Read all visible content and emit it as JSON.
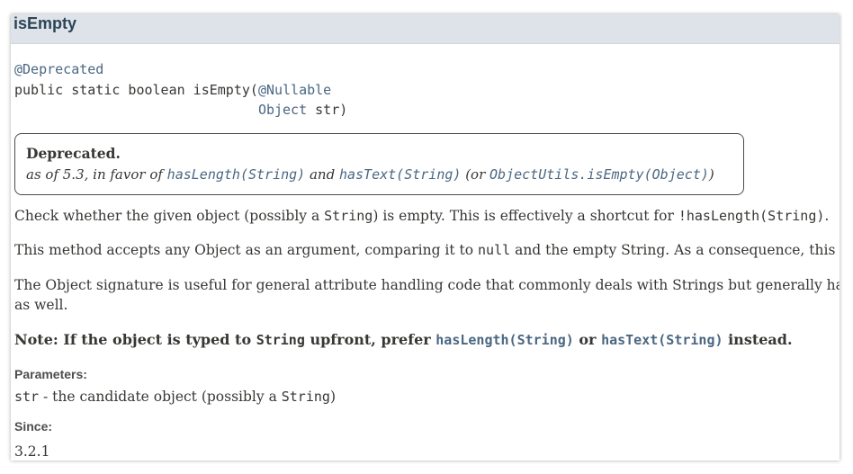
{
  "header": {
    "title": "isEmpty"
  },
  "signature": {
    "annotation": "@Deprecated",
    "declaration": "public static boolean isEmpty(",
    "param_annotation": "@Nullable",
    "param_type": "Object",
    "param_name": " str)"
  },
  "deprecation": {
    "title": "Deprecated.",
    "prefix": "as of 5.3, in favor of ",
    "link1": "hasLength(String)",
    "and": " and ",
    "link2": "hasText(String)",
    "or": " (or ",
    "link3": "ObjectUtils.isEmpty(Object)",
    "suffix": ")"
  },
  "description": {
    "p1_a": "Check whether the given object (possibly a ",
    "p1_code1": "String",
    "p1_b": ") is empty. This is effectively a shortcut for ",
    "p1_code2": "!hasLength(String)",
    "p1_c": ".",
    "p2_a": "This method accepts any Object as an argument, comparing it to ",
    "p2_code": "null",
    "p2_b": " and the empty String. As a consequence, this method will n",
    "p3_line1": "The Object signature is useful for general attribute handling code that commonly deals with Strings but generally has to iterate ove",
    "p3_line2": "as well."
  },
  "note": {
    "a": "Note: If the object is typed to ",
    "code": "String",
    "b": " upfront, prefer ",
    "link1": "hasLength(String)",
    "c": " or ",
    "link2": "hasText(String)",
    "d": " instead."
  },
  "parameters": {
    "label": "Parameters:",
    "name": "str",
    "desc_a": " - the candidate object (possibly a ",
    "desc_code": "String",
    "desc_b": ")"
  },
  "since": {
    "label": "Since:",
    "version": "3.2.1"
  },
  "colors": {
    "header_bg": "#dee3e9",
    "link": "#4a6782",
    "text": "#353833"
  }
}
